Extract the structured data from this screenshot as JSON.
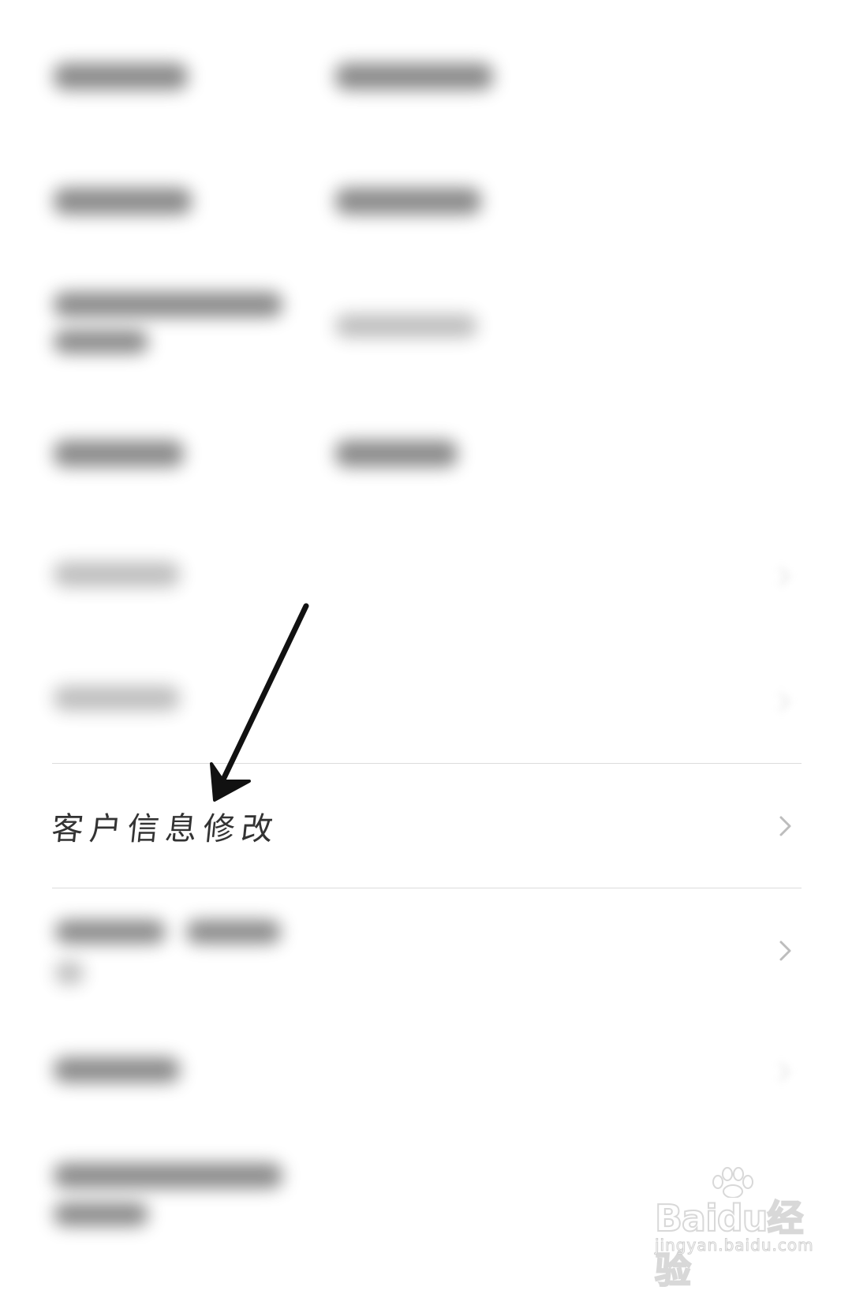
{
  "list": {
    "highlighted_item": {
      "label": "客户信息修改"
    }
  },
  "icons": {
    "chevron": "chevron-right-icon",
    "annotation": "arrow-pointer-icon"
  },
  "watermark": {
    "logo": "Baidu经验",
    "url": "jingyan.baidu.com"
  },
  "colors": {
    "background": "#ffffff",
    "divider": "#dcdcdc",
    "chevron": "#bdbdbd",
    "label": "#333333",
    "annotation": "#111111"
  }
}
